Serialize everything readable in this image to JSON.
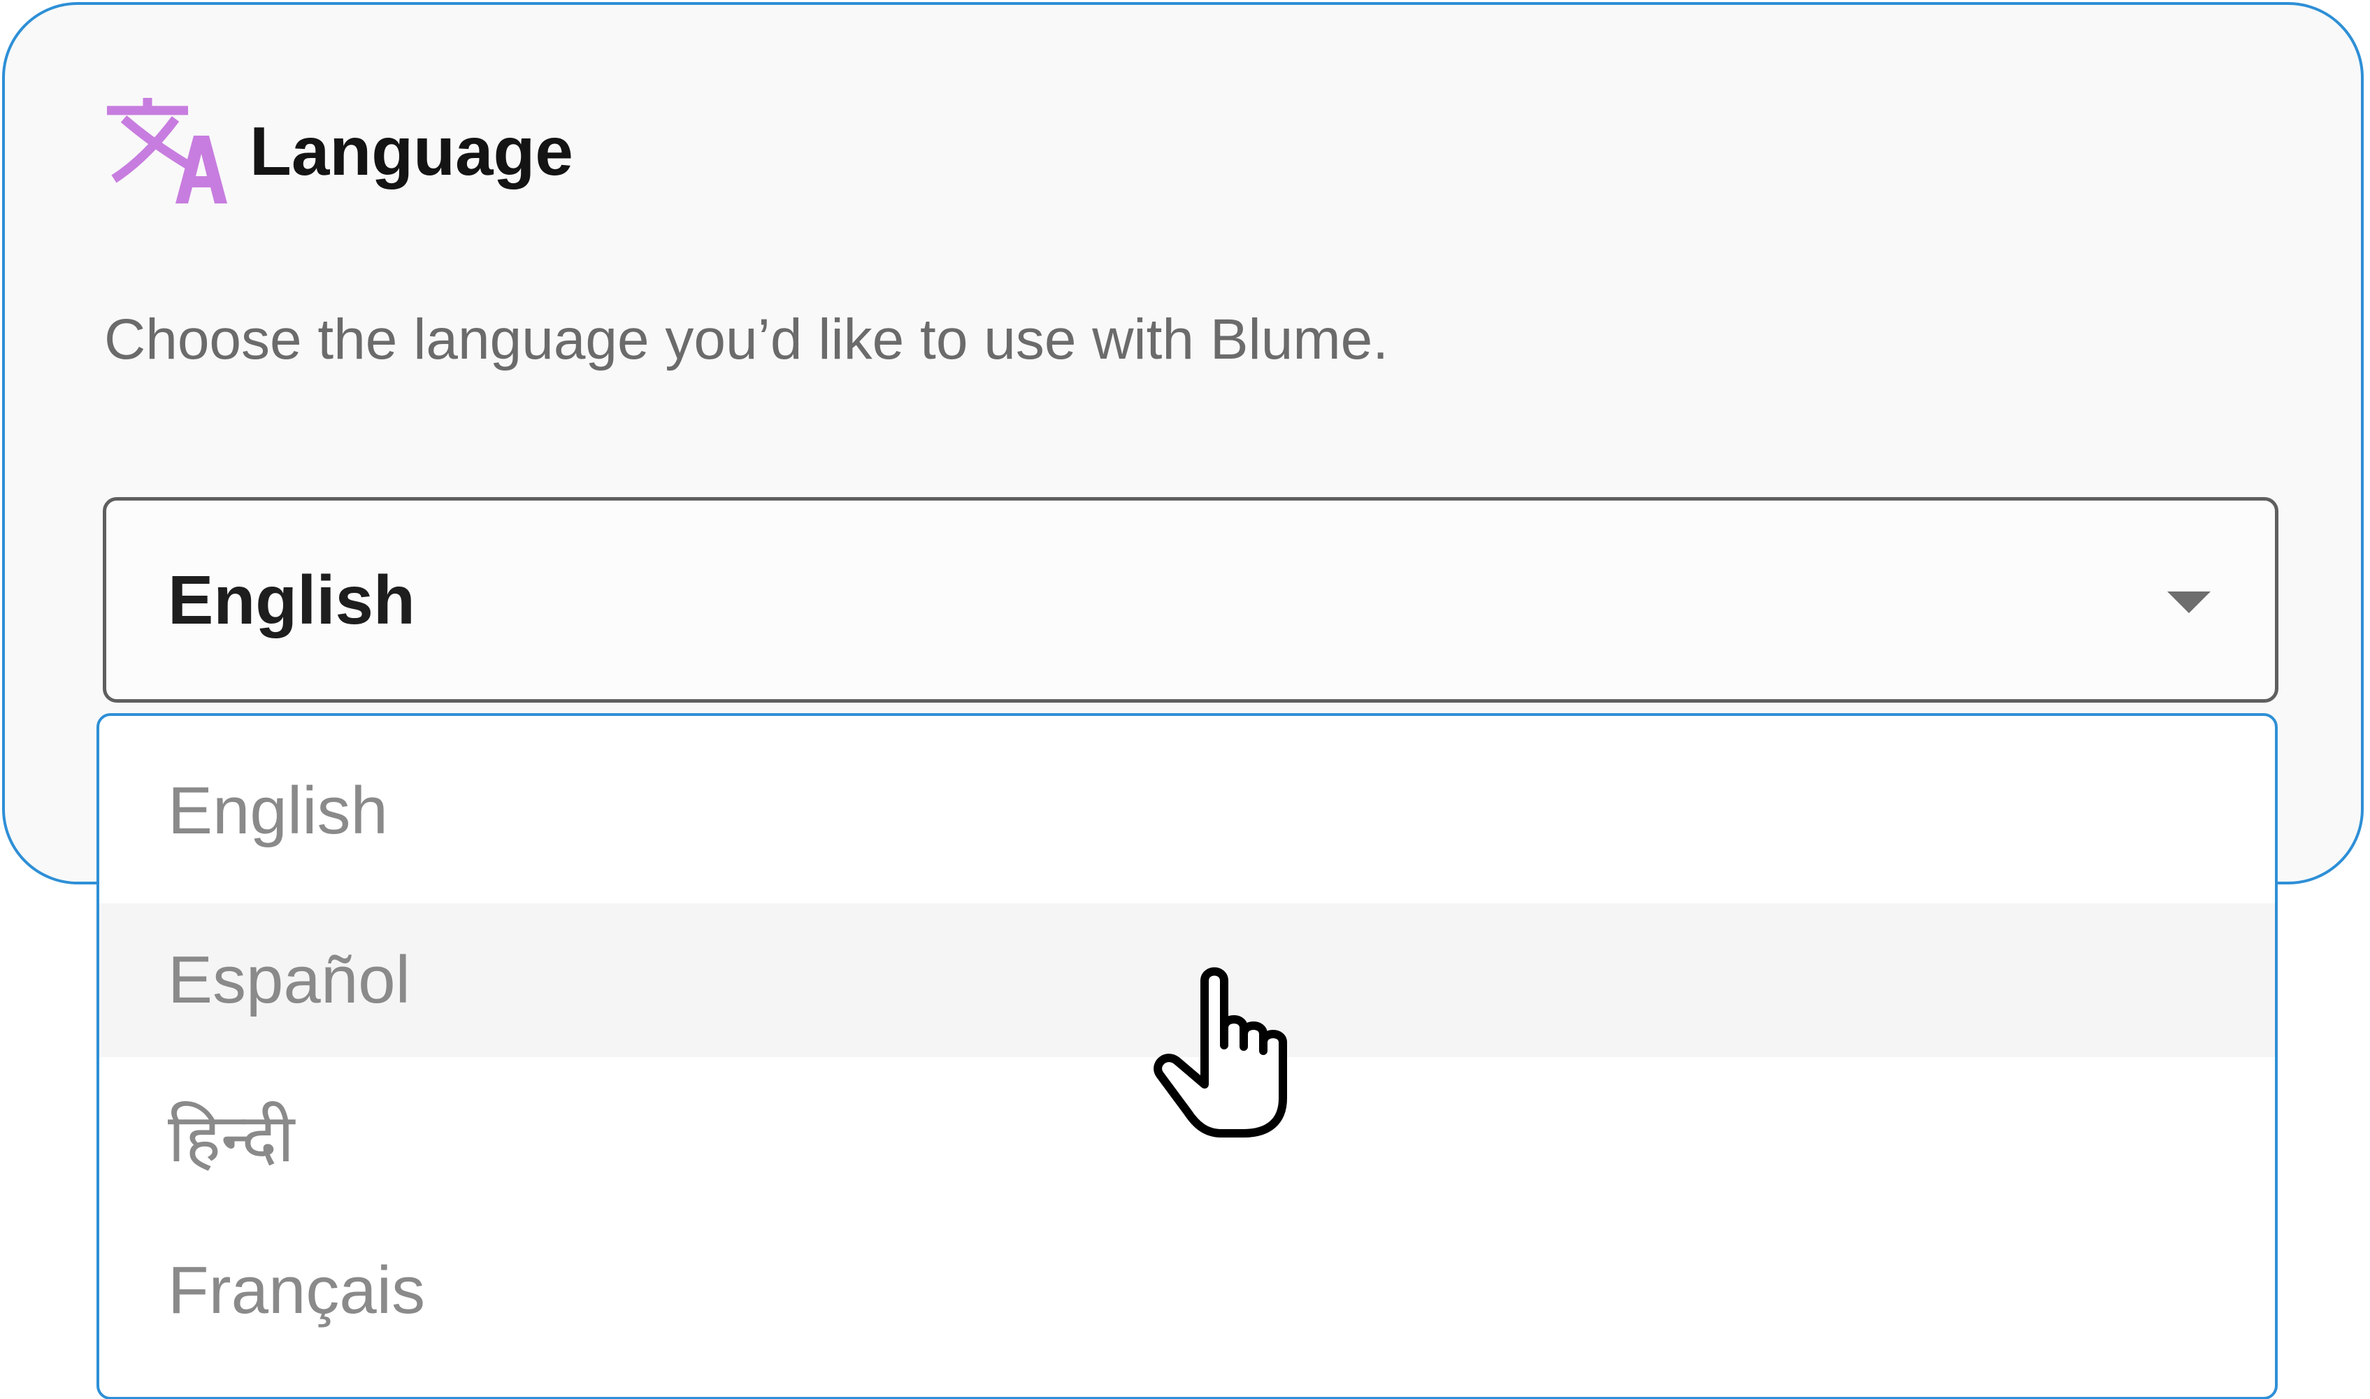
{
  "card": {
    "title": "Language",
    "description": "Choose the language you’d like to use with Blume.",
    "icon": "translate-icon",
    "icon_color": "#c77ddf"
  },
  "select": {
    "value": "English",
    "caret_icon": "caret-down-icon"
  },
  "dropdown": {
    "options": [
      {
        "label": "English"
      },
      {
        "label": "Español"
      },
      {
        "label": "हिन्दी"
      },
      {
        "label": "Français"
      }
    ],
    "hovered_index": 1
  },
  "cursor": {
    "icon": "hand-pointer-cursor-icon"
  },
  "colors": {
    "accent_border": "#2e8fd6",
    "card_background": "#f9f9f9",
    "hover_background": "#f5f5f5",
    "option_text": "#8a8a8a"
  }
}
